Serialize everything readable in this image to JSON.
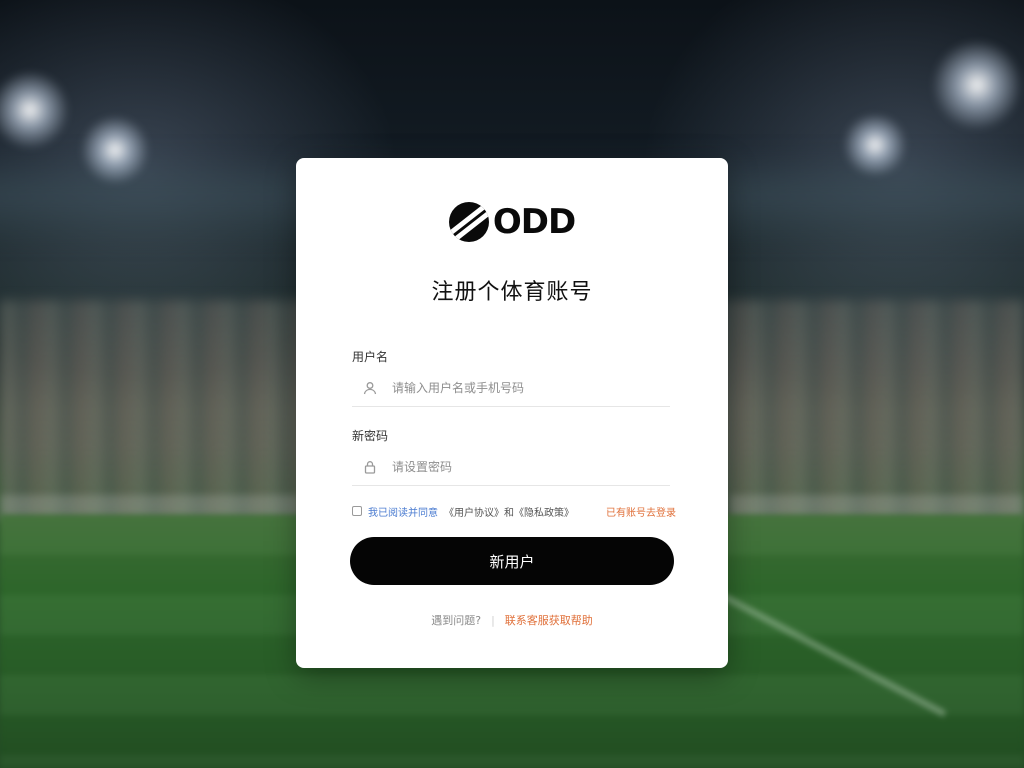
{
  "brand": {
    "logo_text": "ODD",
    "logo_icon": "odd-logo-mark"
  },
  "form": {
    "title": "注册个体育账号",
    "username": {
      "label": "用户名",
      "icon": "user-icon",
      "placeholder": "请输入用户名或手机号码"
    },
    "password": {
      "label": "新密码",
      "icon": "lock-icon",
      "placeholder": "请设置密码"
    },
    "options": {
      "checkbox_icon": "checkbox",
      "agreement_link": "我已阅读并同意",
      "agreement_text": "《用户协议》和《隐私政策》",
      "right_link": "已有账号去登录"
    },
    "submit_label": "新用户"
  },
  "footer": {
    "left_text": "遇到问题?",
    "separator": "|",
    "right_link": "联系客服获取帮助"
  },
  "colors": {
    "primary": "#050505",
    "accent": "#e0703a",
    "link": "#4a7bd0",
    "card_bg": "#ffffff"
  }
}
